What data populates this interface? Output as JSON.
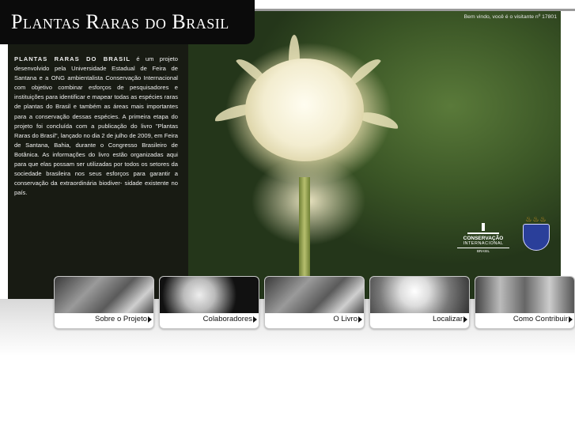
{
  "header": {
    "logo_text": "Plantas Raras do Brasil"
  },
  "hero": {
    "welcome": "Bem vindo, você é o visitante nº 17801",
    "about_lead": "PLANTAS RARAS DO BRASIL",
    "about_body": " é um projeto desenvolvido pela Universidade Estadual de Feira de Santana e a ONG ambientalista Conservação Internacional com objetivo combinar esforços de pesquisadores e instituições para identificar e mapear todas as espécies raras de plantas do Brasil e também as áreas mais importantes para a conservação dessas espécies. A primeira etapa do projeto foi concluída com a publicação do livro \"Plantas Raras do Brasil\", lançado no dia 2 de julho de 2009, em Feira de Santana, Bahia, durante o Congresso Brasileiro de Botânica. As informações do livro estão organizadas aqui para que elas possam ser utilizadas por todos os setores da sociedade brasileira nos seus esforços para garantir a conservação da extraordinária biodiver- sidade existente no país.",
    "partner_ci": {
      "line1": "CONSERVAÇÃO",
      "line2": "INTERNACIONAL",
      "line3": "BRASIL"
    },
    "partner_uefs_icon": "uefs-shield-icon"
  },
  "nav": [
    {
      "label": "Sobre o Projeto"
    },
    {
      "label": "Colaboradores"
    },
    {
      "label": "O Livro"
    },
    {
      "label": "Localizar"
    },
    {
      "label": "Como Contribuir"
    }
  ]
}
